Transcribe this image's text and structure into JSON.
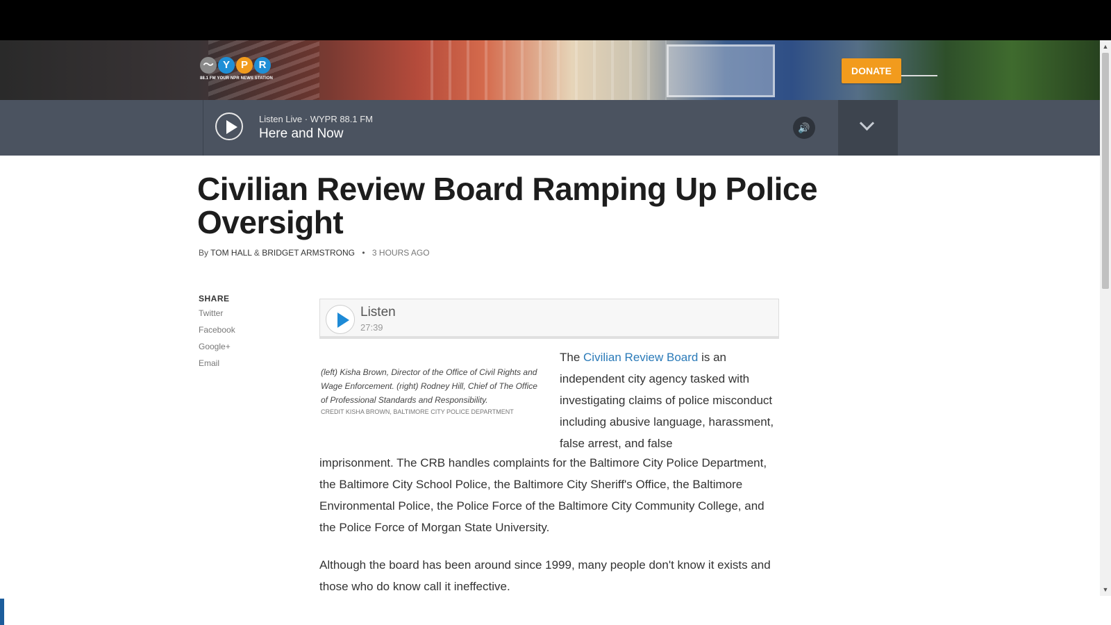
{
  "header": {
    "logo": {
      "letters": [
        "〜",
        "Y",
        "P",
        "R"
      ],
      "colors": [
        "#8a8a8a",
        "#1f8fd6",
        "#f29b1d",
        "#1f8fd6"
      ],
      "tagline": "88.1 FM YOUR NPR NEWS STATION"
    },
    "donate_label": "DONATE",
    "donate_color": "#f29b1d"
  },
  "player": {
    "live_label": "Listen Live · WYPR 88.1 FM",
    "program": "Here and Now",
    "play_icon": "play-icon",
    "volume_icon": "speaker-icon",
    "expand_icon": "chevron-down-icon"
  },
  "article": {
    "title": "Civilian Review Board Ramping Up Police Oversight",
    "byline": {
      "by": "By",
      "author1": "Tom Hall",
      "amp": "&",
      "author2": "Bridget Armstrong",
      "dot": "•",
      "time": "3 hours ago"
    },
    "share": {
      "heading": "SHARE",
      "items": [
        "Twitter",
        "Facebook",
        "Google+",
        "Email"
      ]
    },
    "audio": {
      "label": "Listen",
      "duration": "27:39"
    },
    "caption": "(left) Kisha Brown, Director of the Office of Civil Rights and Wage Enforcement. (right) Rodney Hill, Chief of The Office of Professional Standards and Responsibility.",
    "credit": "CREDIT KISHA BROWN, BALTIMORE CITY POLICE DEPARTMENT",
    "para1": {
      "pre": "The ",
      "link": "Civilian Review Board",
      "post": " is an independent city agency tasked with investigating claims of police misconduct including abusive language, harassment, false arrest, and false"
    },
    "para1_cont": "imprisonment.  The CRB handles complaints for the Baltimore City Police Department, the Baltimore City School Police, the Baltimore City Sheriff's Office, the Baltimore Environmental Police, the Police Force of the Baltimore City Community College, and the Police Force of Morgan State University.",
    "para2": "Although the board has been around since 1999, many people don't know it exists and those who do know call it ineffective."
  },
  "colors": {
    "link": "#2a7ab8",
    "player_bg": "#4b5360",
    "audio_play": "#1d8ad6"
  }
}
